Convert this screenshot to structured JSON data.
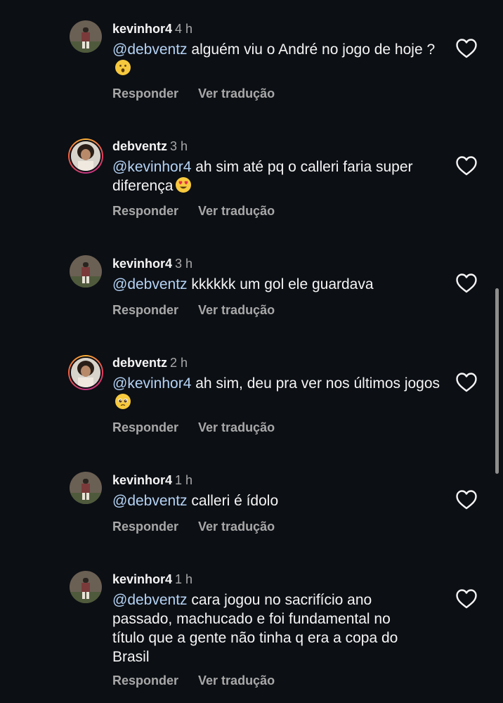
{
  "comments": [
    {
      "username": "kevinhor4",
      "time": "4 h",
      "mention": "@debventz",
      "text": " alguém viu o André no jogo de hoje ?",
      "emoji": "hushed-face-emoji",
      "reply_label": "Responder",
      "translate_label": "Ver tradução"
    },
    {
      "username": "debventz",
      "time": "3 h",
      "mention": "@kevinhor4",
      "text": " ah sim até pq o calleri faria super diferença",
      "emoji": "heart-eyes-emoji",
      "reply_label": "Responder",
      "translate_label": "Ver tradução"
    },
    {
      "username": "kevinhor4",
      "time": "3 h",
      "mention": "@debventz",
      "text": " kkkkkk um gol ele guardava",
      "reply_label": "Responder",
      "translate_label": "Ver tradução"
    },
    {
      "username": "debventz",
      "time": "2 h",
      "mention": "@kevinhor4",
      "text": " ah sim, deu pra ver nos últimos jogos",
      "emoji": "pleading-face-emoji",
      "reply_label": "Responder",
      "translate_label": "Ver tradução"
    },
    {
      "username": "kevinhor4",
      "time": "1 h",
      "mention": "@debventz",
      "text": " calleri é ídolo",
      "reply_label": "Responder",
      "translate_label": "Ver tradução"
    },
    {
      "username": "kevinhor4",
      "time": "1 h",
      "mention": "@debventz",
      "text": " cara jogou no sacrifício ano passado, machucado e foi fundamental no título que a gente não tinha q era a copa do Brasil",
      "reply_label": "Responder",
      "translate_label": "Ver tradução"
    }
  ],
  "icons": {
    "like": "heart-outline-icon",
    "avatar_kevinhor4": "avatar-player-photo",
    "avatar_debventz": "avatar-selfie-photo-story-ring"
  },
  "colors": {
    "background": "#0c0f14",
    "text": "#f5f5f5",
    "mention": "#b4d3f5",
    "secondary": "#a8a8a8"
  }
}
